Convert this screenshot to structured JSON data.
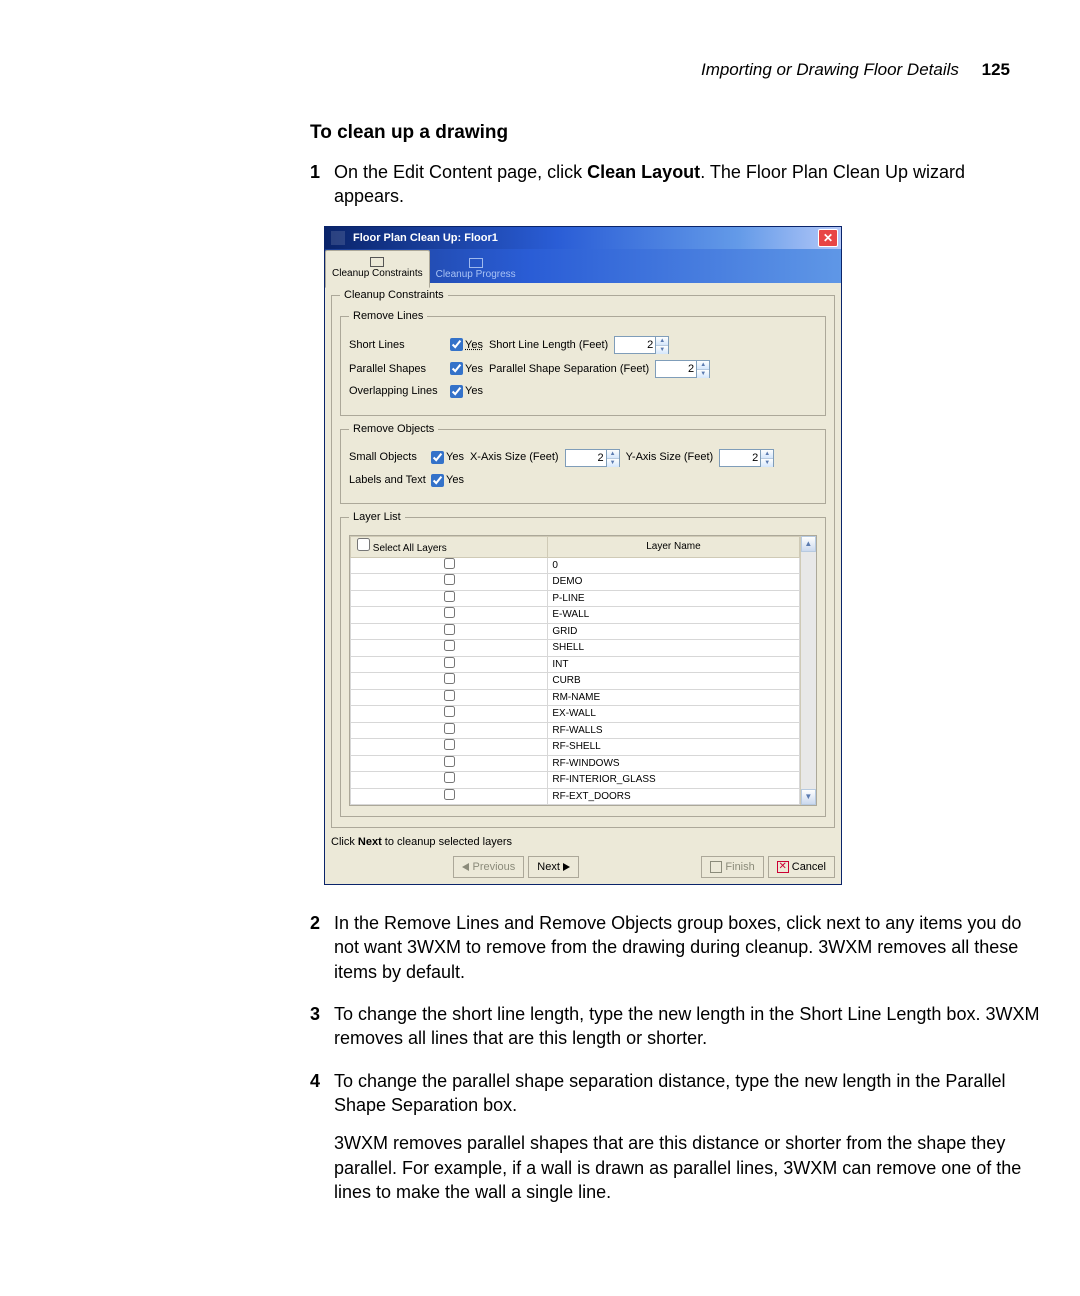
{
  "page_header": {
    "breadcrumb": "Importing or Drawing Floor Details",
    "page_number": "125"
  },
  "section_title": "To clean up a drawing",
  "step1": {
    "num": "1",
    "prefix": "On the Edit Content page, click ",
    "bold": "Clean Layout",
    "suffix": ". The Floor Plan Clean Up wizard appears."
  },
  "dialog": {
    "title": "Floor Plan Clean Up: Floor1",
    "tab_active": "Cleanup Constraints",
    "tab_inactive": "Cleanup Progress",
    "groups": {
      "constraints_legend": "Cleanup Constraints",
      "removelines_legend": "Remove Lines",
      "short_lines_label": "Short Lines",
      "short_lines_yes": "Yes",
      "short_line_len_label": "Short Line Length (Feet)",
      "short_line_len_value": "2",
      "parallel_label": "Parallel Shapes",
      "parallel_yes": "Yes",
      "parallel_sep_label": "Parallel Shape Separation (Feet)",
      "parallel_sep_value": "2",
      "overlap_label": "Overlapping Lines",
      "overlap_yes": "Yes",
      "removeobjects_legend": "Remove Objects",
      "small_obj_label": "Small Objects",
      "small_obj_yes": "Yes",
      "xaxis_label": "X-Axis Size (Feet)",
      "xaxis_value": "2",
      "yaxis_label": "Y-Axis Size (Feet)",
      "yaxis_value": "2",
      "labels_text_label": "Labels and Text",
      "labels_text_yes": "Yes",
      "layer_legend": "Layer List",
      "select_all_label": "Select All Layers",
      "layer_col": "Layer Name",
      "layers": [
        "0",
        "DEMO",
        "P-LINE",
        "E-WALL",
        "GRID",
        "SHELL",
        "INT",
        "CURB",
        "RM-NAME",
        "EX-WALL",
        "RF-WALLS",
        "RF-SHELL",
        "RF-WINDOWS",
        "RF-INTERIOR_GLASS",
        "RF-EXT_DOORS"
      ]
    },
    "hint_prefix": "Click ",
    "hint_bold": "Next",
    "hint_suffix": " to cleanup selected layers",
    "btn_prev": "Previous",
    "btn_next": "Next",
    "btn_finish": "Finish",
    "btn_cancel": "Cancel"
  },
  "step2": {
    "num": "2",
    "text": "In the Remove Lines and Remove Objects group boxes, click next to any items you do not want 3WXM to remove from the drawing during cleanup. 3WXM removes all these items by default."
  },
  "step3": {
    "num": "3",
    "text": "To change the short line length, type the new length in the Short Line Length box. 3WXM removes all lines that are this length or shorter."
  },
  "step4": {
    "num": "4",
    "text": "To change the parallel shape separation distance, type the new length in the Parallel Shape Separation box.",
    "para2": "3WXM removes parallel shapes that are this distance or shorter from the shape they parallel. For example, if a wall is drawn as parallel lines, 3WXM can remove one of the lines to make the wall a single line."
  }
}
